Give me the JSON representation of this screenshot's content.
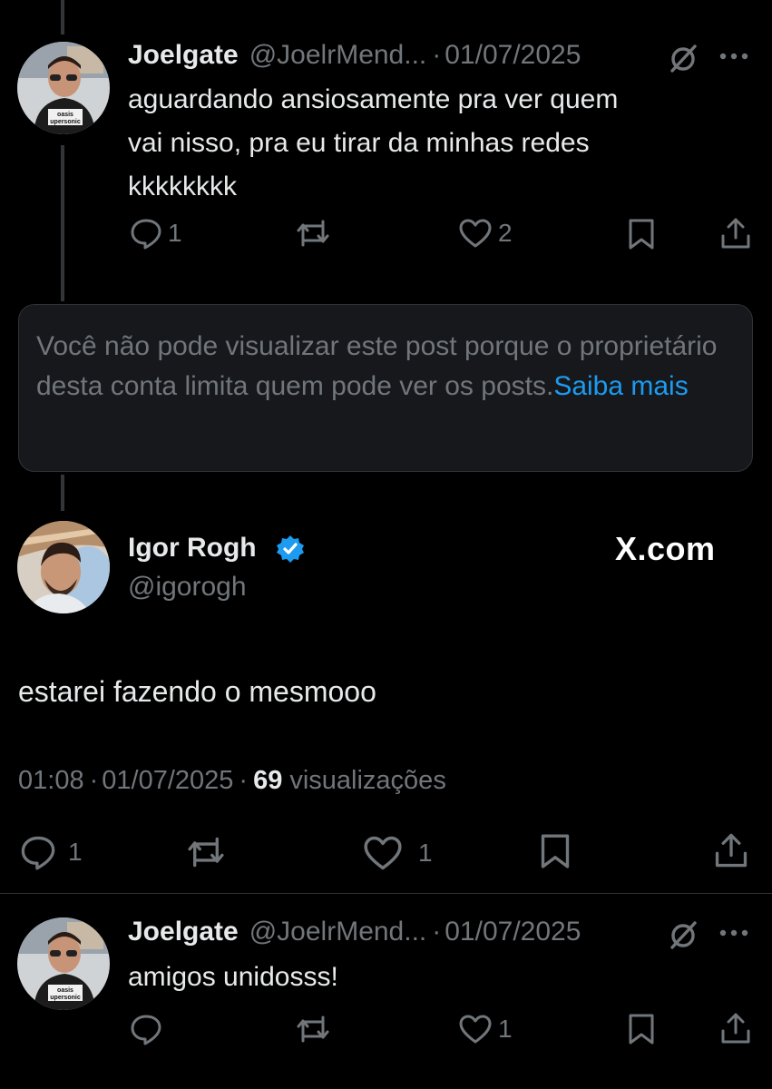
{
  "reply1": {
    "display_name": "Joelgate",
    "handle": "@JoelrMend...",
    "separator": "·",
    "date": "01/07/2025",
    "text": "aguardando ansiosamente pra ver quem\nvai nisso, pra eu tirar da minhas redes\nkkkkkkkk",
    "reply_count": "1",
    "like_count": "2",
    "avatar_shirt_text_1": "oasis",
    "avatar_shirt_text_2": "upersonic"
  },
  "tombstone": {
    "text": "Você não pode visualizar este post porque o proprietário desta conta limita quem pode ver os posts.",
    "link_label": "Saiba mais"
  },
  "main_post": {
    "display_name": "Igor Rogh",
    "handle": "@igorogh",
    "brand": "X.com",
    "text": "estarei fazendo o mesmooo",
    "time": "01:08",
    "separator": "·",
    "date": "01/07/2025",
    "views_count": "69",
    "views_label": "visualizações",
    "reply_count": "1",
    "like_count": "1"
  },
  "reply2": {
    "display_name": "Joelgate",
    "handle": "@JoelrMend...",
    "separator": "·",
    "date": "01/07/2025",
    "text": "amigos unidosss!",
    "like_count": "1",
    "avatar_shirt_text_1": "oasis",
    "avatar_shirt_text_2": "upersonic"
  },
  "colors": {
    "background": "#000000",
    "text": "#e7e9ea",
    "muted": "#71767b",
    "link": "#1d9bf0",
    "verified": "#1d9bf0",
    "tombstone_bg": "#16181c"
  }
}
